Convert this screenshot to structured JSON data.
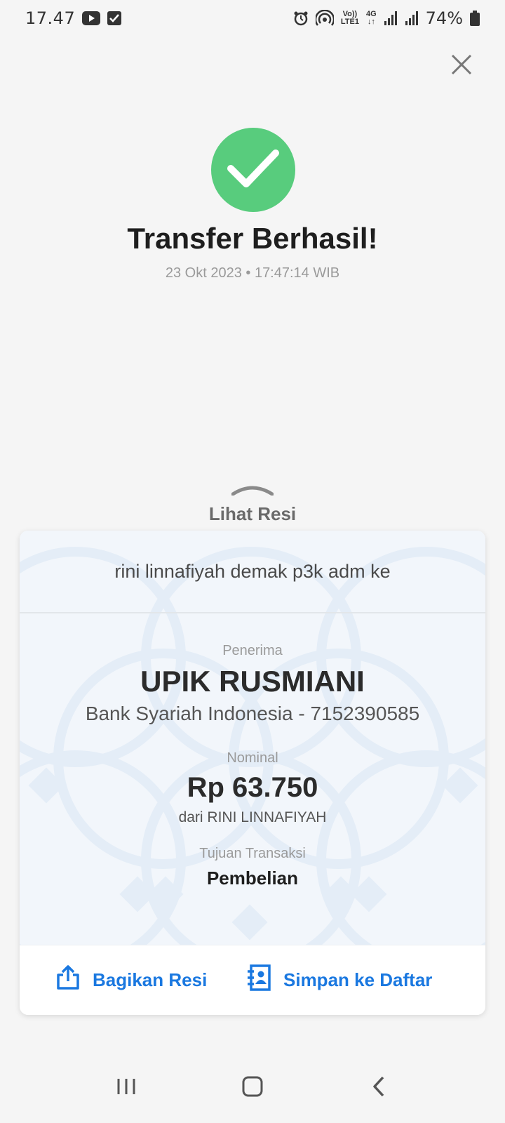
{
  "status_bar": {
    "time": "17.47",
    "battery": "74%",
    "volte_line1": "Vo))",
    "volte_line2": "LTE1",
    "network": "4G",
    "icons": [
      "youtube-icon",
      "checkbox-icon",
      "alarm-icon",
      "hotspot-icon",
      "volte-icon",
      "4g-icon",
      "signal-icon",
      "signal-icon",
      "battery-icon"
    ]
  },
  "header": {
    "title": "Transfer Berhasil!",
    "datetime": "23 Okt 2023 • 17:47:14 WIB",
    "status_color": "#58cc7d"
  },
  "receipt_toggle": {
    "label": "Lihat Resi"
  },
  "receipt": {
    "note": "rini linnafiyah demak p3k adm ke",
    "recipient_label": "Penerima",
    "recipient_name": "UPIK RUSMIANI",
    "recipient_bank": "Bank Syariah Indonesia - 7152390585",
    "amount_label": "Nominal",
    "amount": "Rp 63.750",
    "from": "dari RINI LINNAFIYAH",
    "purpose_label": "Tujuan Transaksi",
    "purpose": "Pembelian"
  },
  "actions": {
    "share_label": "Bagikan Resi",
    "save_label": "Simpan ke Daftar",
    "accent_color": "#1a78e0"
  },
  "nav_bar": {
    "icons": [
      "recents-icon",
      "home-icon",
      "back-icon"
    ]
  }
}
